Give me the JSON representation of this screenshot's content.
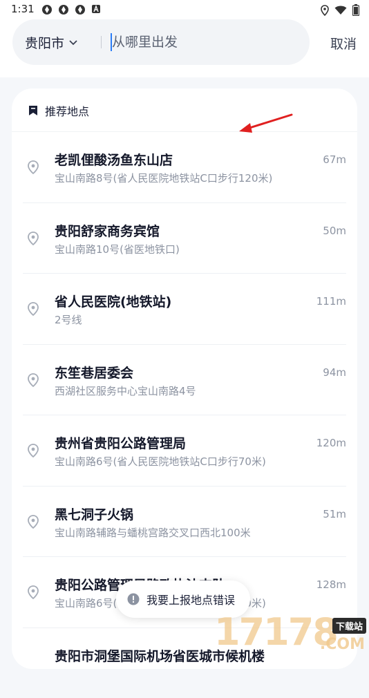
{
  "status_bar": {
    "time": "1:31",
    "left_icons": [
      "sync-icon",
      "sync-icon",
      "sync-icon",
      "a-icon"
    ],
    "right_icons": [
      "location-icon",
      "wifi-icon",
      "battery-icon"
    ]
  },
  "header": {
    "city": "贵阳市",
    "search_placeholder": "从哪里出发",
    "cancel_label": "取消"
  },
  "card": {
    "title": "推荐地点",
    "items": [
      {
        "name": "老凯俚酸汤鱼东山店",
        "address": "宝山南路8号(省人民医院地铁站C口步行120米)",
        "distance": "67m"
      },
      {
        "name": "贵阳舒家商务宾馆",
        "address": "宝山南路10号(省医地铁口)",
        "distance": "50m"
      },
      {
        "name": "省人民医院(地铁站)",
        "address": "2号线",
        "distance": "111m"
      },
      {
        "name": "东笙巷居委会",
        "address": "西湖社区服务中心宝山南路4号",
        "distance": "94m"
      },
      {
        "name": "贵州省贵阳公路管理局",
        "address": "宝山南路6号(省人民医院地铁站C口步行70米)",
        "distance": "120m"
      },
      {
        "name": "黑七洞子火锅",
        "address": "宝山南路辅路与蟠桃宫路交叉口西北100米",
        "distance": "51m"
      },
      {
        "name": "贵阳公路管理局路政执法支队",
        "address": "宝山南路6号(省人民医院地铁站C口步行60米)",
        "distance": "128m"
      },
      {
        "name": "贵阳市洞堡国际机场省医城市候机楼",
        "address": "",
        "distance": ""
      }
    ]
  },
  "toast": {
    "label": "我要上报地点错误"
  },
  "watermark": {
    "number": "17178",
    "badge": "下载站",
    "suffix": ".COM"
  },
  "colors": {
    "accent": "#2a7cf6",
    "annotation_arrow": "#e02020",
    "background": "#f5f7fa"
  }
}
